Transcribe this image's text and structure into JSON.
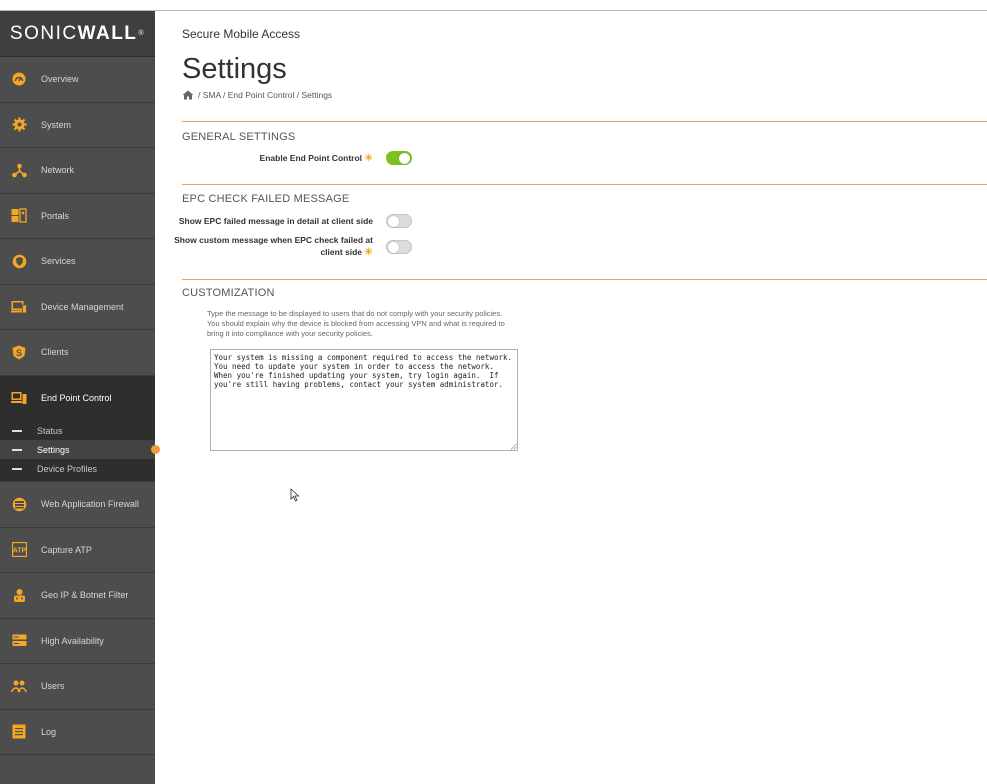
{
  "brand": {
    "logo_light": "SONIC",
    "logo_bold": "WALL",
    "logo_tm": "®"
  },
  "sidebar": {
    "items": [
      {
        "label": "Overview",
        "icon": "gauge-icon"
      },
      {
        "label": "System",
        "icon": "gear-icon"
      },
      {
        "label": "Network",
        "icon": "network-icon"
      },
      {
        "label": "Portals",
        "icon": "portals-icon"
      },
      {
        "label": "Services",
        "icon": "shield-icon"
      },
      {
        "label": "Device Management",
        "icon": "device-icon"
      },
      {
        "label": "Clients",
        "icon": "clients-icon"
      },
      {
        "label": "End Point Control",
        "icon": "endpoint-icon"
      },
      {
        "label": "Web Application Firewall",
        "icon": "firewall-icon"
      },
      {
        "label": "Capture ATP",
        "icon": "capture-icon"
      },
      {
        "label": "Geo IP & Botnet Filter",
        "icon": "geo-icon"
      },
      {
        "label": "High Availability",
        "icon": "server-icon"
      },
      {
        "label": "Users",
        "icon": "users-icon"
      },
      {
        "label": "Log",
        "icon": "log-icon"
      }
    ],
    "sub_items": [
      {
        "label": "Status"
      },
      {
        "label": "Settings"
      },
      {
        "label": "Device Profiles"
      }
    ]
  },
  "header": {
    "app_title": "Secure Mobile Access",
    "page_title": "Settings",
    "breadcrumb": "/ SMA / End Point Control / Settings"
  },
  "general": {
    "title": "GENERAL SETTINGS",
    "enable_label": "Enable End Point Control",
    "enable_on": true
  },
  "epc": {
    "title": "EPC CHECK FAILED MESSAGE",
    "detail_label": "Show EPC failed message in detail at client side",
    "detail_on": false,
    "custom_label_1": "Show custom message when EPC check failed at",
    "custom_label_2": "client side",
    "custom_on": false
  },
  "customization": {
    "title": "CUSTOMIZATION",
    "description": "Type the message to be displayed to users that do not comply with your security policies. You should explain why the device is blocked from accessing VPN and what is required to bring it into compliance with your security policies.",
    "message": "Your system is missing a component required to access the network.  You need to update your system in order to access the network. When you're finished updating your system, try login again.  If you're still having problems, contact your system administrator."
  },
  "colors": {
    "accent": "#f39c3c",
    "toggle_on": "#7cc11f",
    "sidebar": "#4d4d4d",
    "divider": "#f0a060"
  }
}
